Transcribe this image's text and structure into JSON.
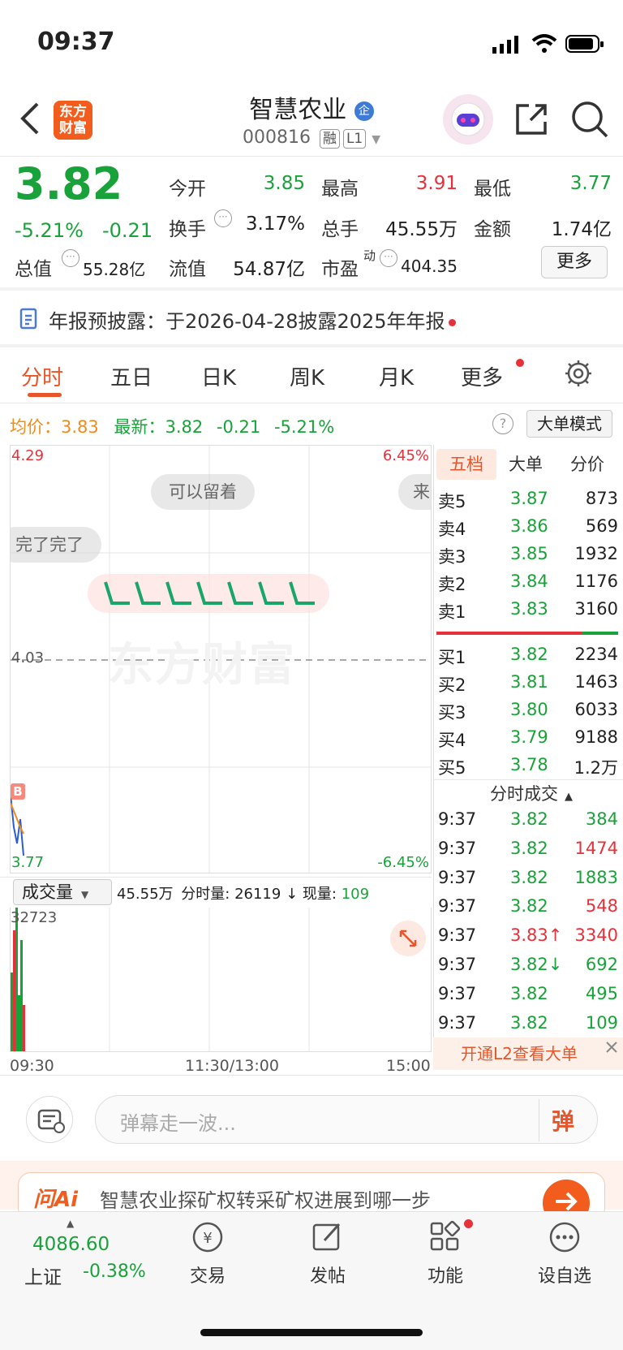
{
  "status": {
    "time": "09:37"
  },
  "header": {
    "title": "智慧农业",
    "code": "000816",
    "tag1": "融",
    "tag2": "L1",
    "logo_text": "东方财富",
    "badge": "企"
  },
  "quote": {
    "price": "3.82",
    "pct": "-5.21%",
    "chg": "-0.21",
    "open_label": "今开",
    "open": "3.85",
    "high_label": "最高",
    "high": "3.91",
    "low_label": "最低",
    "low": "3.77",
    "turnover_label": "换手",
    "turnover": "3.17%",
    "volume_label": "总手",
    "volume": "45.55万",
    "amount_label": "金额",
    "amount": "1.74亿",
    "mcap_label": "总值",
    "mcap": "55.28亿",
    "float_label": "流值",
    "float_cap": "54.87亿",
    "pe_label": "市盈",
    "pe_sup": "动",
    "pe": "404.35",
    "more": "更多"
  },
  "notice": "年报预披露：于2026-04-28披露2025年年报",
  "tabs": [
    "分时",
    "五日",
    "日K",
    "周K",
    "月K",
    "更多"
  ],
  "info": {
    "avg_label": "均价：",
    "avg": "3.83",
    "latest_label": "最新：",
    "latest": "3.82",
    "chg": "-0.21",
    "pct": "-5.21%",
    "mode": "大单模式"
  },
  "chart": {
    "ymax": "4.29",
    "ymin": "3.77",
    "mid": "4.03",
    "pct_top": "6.45%",
    "pct_bot": "-6.45%",
    "watermark": "东方财富",
    "b_marker": "B",
    "danmaku": [
      "可以留着",
      "完了完了",
      "来"
    ],
    "x_labels": [
      "09:30",
      "11:30/13:00",
      "15:00"
    ]
  },
  "volume": {
    "select": "成交量",
    "total": "45.55万",
    "min_label": "分时量:",
    "min_val": "26119",
    "arrow": "↓",
    "now_label": "现量:",
    "now_val": "109",
    "max": "32723"
  },
  "orderbook": {
    "tabs": [
      "五档",
      "大单",
      "分价"
    ],
    "asks": [
      {
        "l": "卖5",
        "p": "3.87",
        "v": "873"
      },
      {
        "l": "卖4",
        "p": "3.86",
        "v": "569"
      },
      {
        "l": "卖3",
        "p": "3.85",
        "v": "1932"
      },
      {
        "l": "卖2",
        "p": "3.84",
        "v": "1176"
      },
      {
        "l": "卖1",
        "p": "3.83",
        "v": "3160"
      }
    ],
    "bids": [
      {
        "l": "买1",
        "p": "3.82",
        "v": "2234"
      },
      {
        "l": "买2",
        "p": "3.81",
        "v": "1463"
      },
      {
        "l": "买3",
        "p": "3.80",
        "v": "6033"
      },
      {
        "l": "买4",
        "p": "3.79",
        "v": "9188"
      },
      {
        "l": "买5",
        "p": "3.78",
        "v": "1.2万"
      }
    ],
    "ticks_title": "分时成交",
    "ticks": [
      {
        "t": "9:37",
        "p": "3.82",
        "v": "384",
        "c": "#1aa23a"
      },
      {
        "t": "9:37",
        "p": "3.82",
        "v": "1474",
        "c": "#e8303a"
      },
      {
        "t": "9:37",
        "p": "3.82",
        "v": "1883",
        "c": "#1aa23a"
      },
      {
        "t": "9:37",
        "p": "3.82",
        "v": "548",
        "c": "#e8303a"
      },
      {
        "t": "9:37",
        "p": "3.83↑",
        "v": "3340",
        "c": "#e8303a"
      },
      {
        "t": "9:37",
        "p": "3.82↓",
        "v": "692",
        "c": "#1aa23a"
      },
      {
        "t": "9:37",
        "p": "3.82",
        "v": "495",
        "c": "#1aa23a"
      },
      {
        "t": "9:37",
        "p": "3.82",
        "v": "109",
        "c": "#1aa23a"
      }
    ],
    "promo": "开通L2查看大单"
  },
  "comment": {
    "placeholder": "弹幕走一波...",
    "btn": "弹"
  },
  "ai": {
    "logo": "问Ai",
    "text": "智慧农业探矿权转采矿权进展到哪一步"
  },
  "bottom": {
    "index_val": "4086.60",
    "index_name": "上证",
    "index_pct": "-0.38%",
    "items": [
      "交易",
      "发帖",
      "功能",
      "设自选"
    ]
  }
}
